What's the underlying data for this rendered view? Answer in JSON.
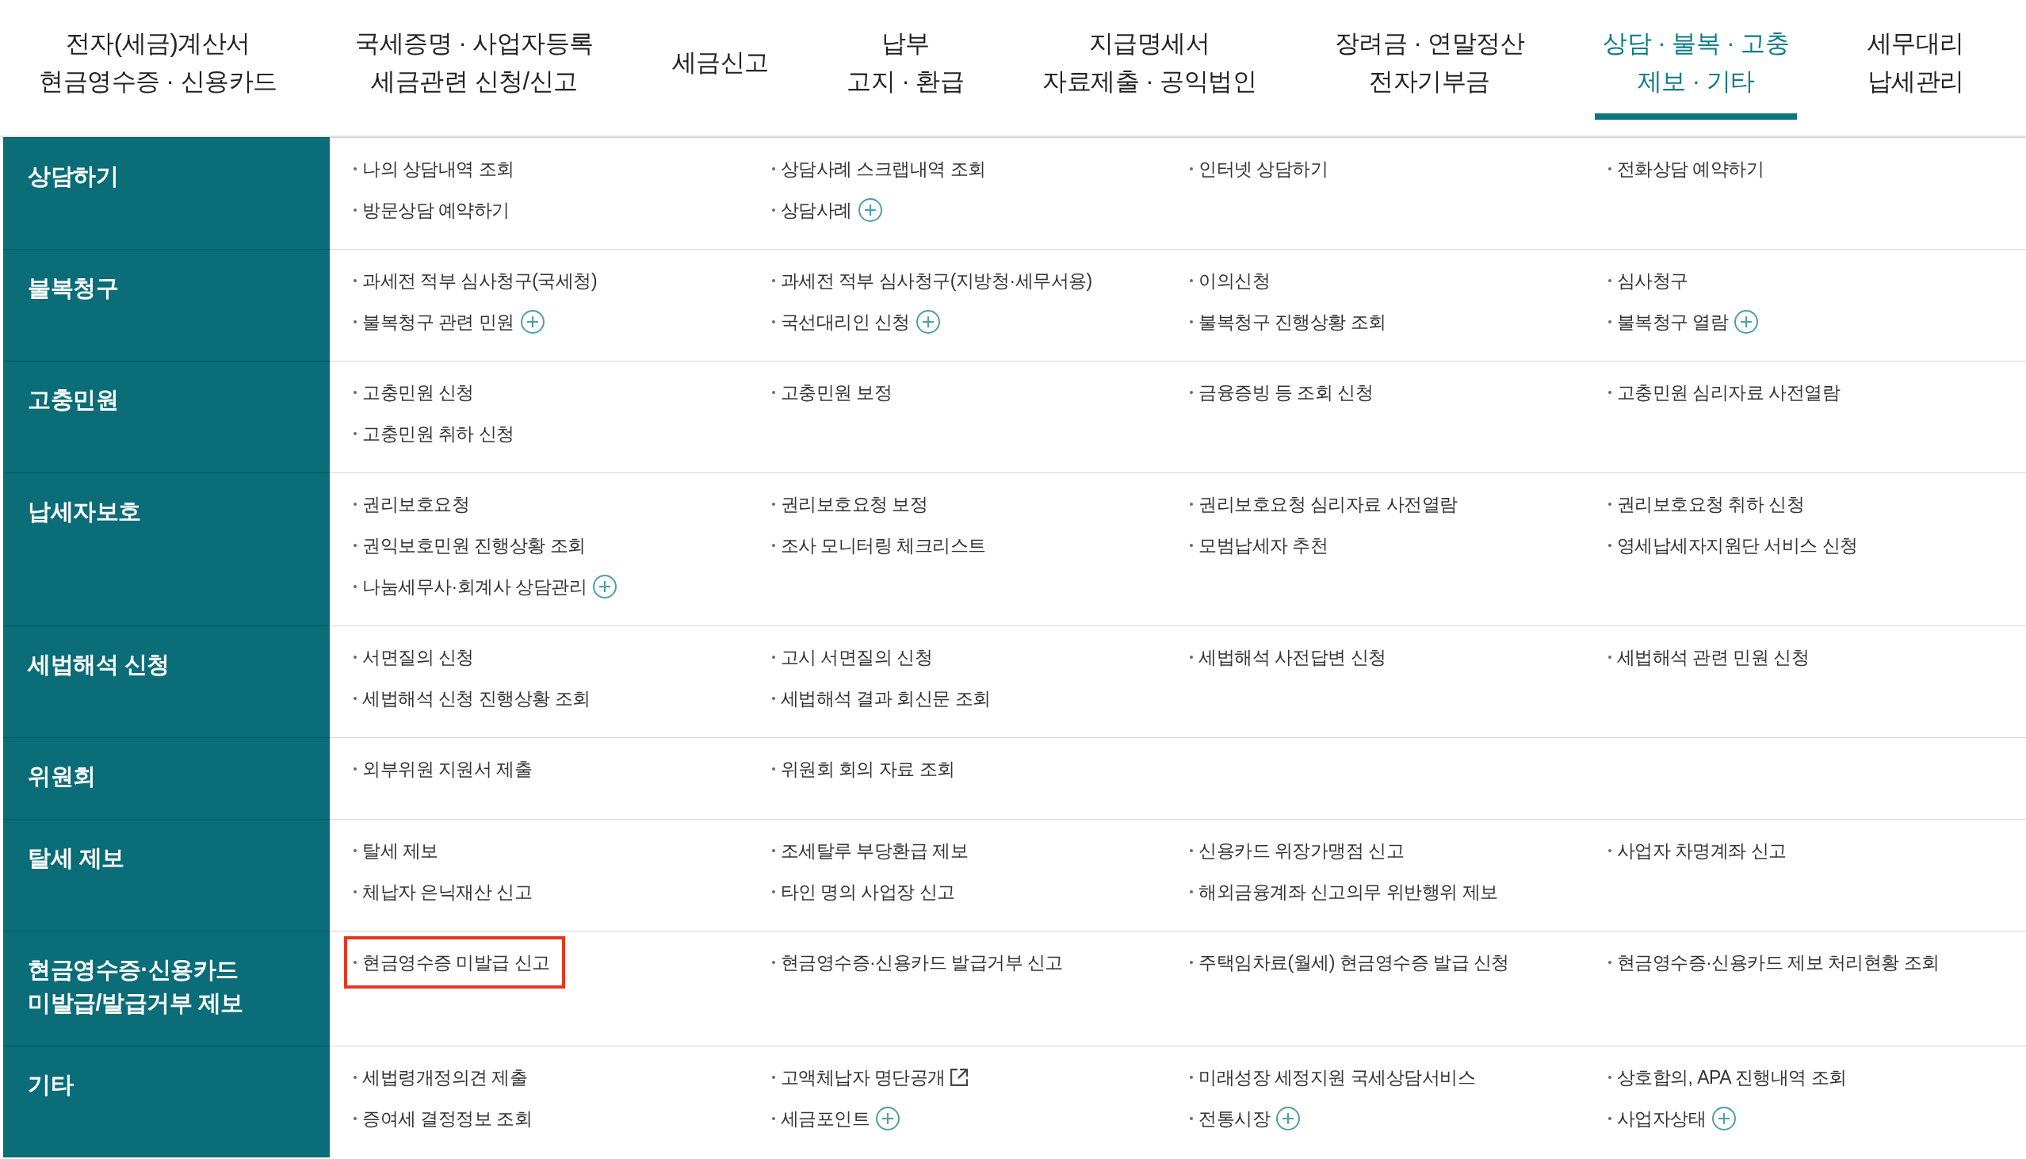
{
  "tabs": [
    {
      "lines": [
        "전자(세금)계산서",
        "현금영수증 · 신용카드"
      ],
      "selected": false
    },
    {
      "lines": [
        "국세증명 · 사업자등록",
        "세금관련 신청/신고"
      ],
      "selected": false
    },
    {
      "lines": [
        "세금신고"
      ],
      "selected": false
    },
    {
      "lines": [
        "납부",
        "고지 · 환급"
      ],
      "selected": false
    },
    {
      "lines": [
        "지급명세서",
        "자료제출 · 공익법인"
      ],
      "selected": false
    },
    {
      "lines": [
        "장려금 · 연말정산",
        "전자기부금"
      ],
      "selected": false
    },
    {
      "lines": [
        "상담 · 불복 · 고충",
        "제보 · 기타"
      ],
      "selected": true
    },
    {
      "lines": [
        "세무대리",
        "납세관리"
      ],
      "selected": false
    }
  ],
  "sections": [
    {
      "title": "상담하기",
      "items": [
        {
          "kind": "plain",
          "label": "나의 상담내역 조회",
          "highlighted": false
        },
        {
          "kind": "plain",
          "label": "상담사례 스크랩내역 조회",
          "highlighted": false
        },
        {
          "kind": "plain",
          "label": "인터넷 상담하기",
          "highlighted": false
        },
        {
          "kind": "plain",
          "label": "전화상담 예약하기",
          "highlighted": false
        },
        {
          "kind": "plain",
          "label": "방문상담 예약하기",
          "highlighted": false
        },
        {
          "kind": "expandable",
          "label": "상담사례",
          "highlighted": false
        }
      ]
    },
    {
      "title": "불복청구",
      "items": [
        {
          "kind": "plain",
          "label": "과세전 적부 심사청구(국세청)",
          "highlighted": false
        },
        {
          "kind": "plain",
          "label": "과세전 적부 심사청구(지방청·세무서용)",
          "highlighted": false
        },
        {
          "kind": "plain",
          "label": "이의신청",
          "highlighted": false
        },
        {
          "kind": "plain",
          "label": "심사청구",
          "highlighted": false
        },
        {
          "kind": "expandable",
          "label": "불복청구 관련 민원",
          "highlighted": false
        },
        {
          "kind": "expandable",
          "label": "국선대리인 신청",
          "highlighted": false
        },
        {
          "kind": "plain",
          "label": "불복청구 진행상황 조회",
          "highlighted": false
        },
        {
          "kind": "expandable",
          "label": "불복청구 열람",
          "highlighted": false
        }
      ]
    },
    {
      "title": "고충민원",
      "items": [
        {
          "kind": "plain",
          "label": "고충민원 신청",
          "highlighted": false
        },
        {
          "kind": "plain",
          "label": "고충민원 보정",
          "highlighted": false
        },
        {
          "kind": "plain",
          "label": "금융증빙 등 조회 신청",
          "highlighted": false
        },
        {
          "kind": "plain",
          "label": "고충민원 심리자료 사전열람",
          "highlighted": false
        },
        {
          "kind": "plain",
          "label": "고충민원 취하 신청",
          "highlighted": false
        }
      ]
    },
    {
      "title": "납세자보호",
      "items": [
        {
          "kind": "plain",
          "label": "권리보호요청",
          "highlighted": false
        },
        {
          "kind": "plain",
          "label": "권리보호요청 보정",
          "highlighted": false
        },
        {
          "kind": "plain",
          "label": "권리보호요청 심리자료 사전열람",
          "highlighted": false
        },
        {
          "kind": "plain",
          "label": "권리보호요청 취하 신청",
          "highlighted": false
        },
        {
          "kind": "plain",
          "label": "권익보호민원 진행상황 조회",
          "highlighted": false
        },
        {
          "kind": "plain",
          "label": "조사 모니터링 체크리스트",
          "highlighted": false
        },
        {
          "kind": "plain",
          "label": "모범납세자 추천",
          "highlighted": false
        },
        {
          "kind": "plain",
          "label": "영세납세자지원단 서비스 신청",
          "highlighted": false
        },
        {
          "kind": "expandable",
          "label": "나눔세무사·회계사 상담관리",
          "highlighted": false
        }
      ]
    },
    {
      "title": "세법해석 신청",
      "items": [
        {
          "kind": "plain",
          "label": "서면질의 신청",
          "highlighted": false
        },
        {
          "kind": "plain",
          "label": "고시 서면질의 신청",
          "highlighted": false
        },
        {
          "kind": "plain",
          "label": "세법해석 사전답변 신청",
          "highlighted": false
        },
        {
          "kind": "plain",
          "label": "세법해석 관련 민원 신청",
          "highlighted": false
        },
        {
          "kind": "plain",
          "label": "세법해석 신청 진행상황 조회",
          "highlighted": false
        },
        {
          "kind": "plain",
          "label": "세법해석 결과 회신문 조회",
          "highlighted": false
        }
      ]
    },
    {
      "title": "위원회",
      "items": [
        {
          "kind": "plain",
          "label": "외부위원 지원서 제출",
          "highlighted": false
        },
        {
          "kind": "plain",
          "label": "위원회 회의 자료 조회",
          "highlighted": false
        }
      ]
    },
    {
      "title": "탈세 제보",
      "items": [
        {
          "kind": "plain",
          "label": "탈세 제보",
          "highlighted": false
        },
        {
          "kind": "plain",
          "label": "조세탈루 부당환급 제보",
          "highlighted": false
        },
        {
          "kind": "plain",
          "label": "신용카드 위장가맹점 신고",
          "highlighted": false
        },
        {
          "kind": "plain",
          "label": "사업자 차명계좌 신고",
          "highlighted": false
        },
        {
          "kind": "plain",
          "label": "체납자 은닉재산 신고",
          "highlighted": false
        },
        {
          "kind": "plain",
          "label": "타인 명의 사업장 신고",
          "highlighted": false
        },
        {
          "kind": "plain",
          "label": "해외금융계좌 신고의무 위반행위 제보",
          "highlighted": false
        }
      ]
    },
    {
      "title": "현금영수증·신용카드 미발급/발급거부 제보",
      "items": [
        {
          "kind": "plain",
          "label": "현금영수증 미발급 신고",
          "highlighted": true
        },
        {
          "kind": "plain",
          "label": "현금영수증·신용카드 발급거부 신고",
          "highlighted": false
        },
        {
          "kind": "plain",
          "label": "주택임차료(월세) 현금영수증 발급 신청",
          "highlighted": false
        },
        {
          "kind": "plain",
          "label": "현금영수증·신용카드 제보 처리현황 조회",
          "highlighted": false
        }
      ]
    },
    {
      "title": "기타",
      "items": [
        {
          "kind": "plain",
          "label": "세법령개정의견 제출",
          "highlighted": false
        },
        {
          "kind": "external",
          "label": "고액체납자 명단공개",
          "highlighted": false
        },
        {
          "kind": "plain",
          "label": "미래성장 세정지원 국세상담서비스",
          "highlighted": false
        },
        {
          "kind": "plain",
          "label": "상호합의, APA 진행내역 조회",
          "highlighted": false
        },
        {
          "kind": "plain",
          "label": "증여세 결정정보 조회",
          "highlighted": false
        },
        {
          "kind": "expandable",
          "label": "세금포인트",
          "highlighted": false
        },
        {
          "kind": "expandable",
          "label": "전통시장",
          "highlighted": false
        },
        {
          "kind": "expandable",
          "label": "사업자상태",
          "highlighted": false
        }
      ]
    }
  ]
}
